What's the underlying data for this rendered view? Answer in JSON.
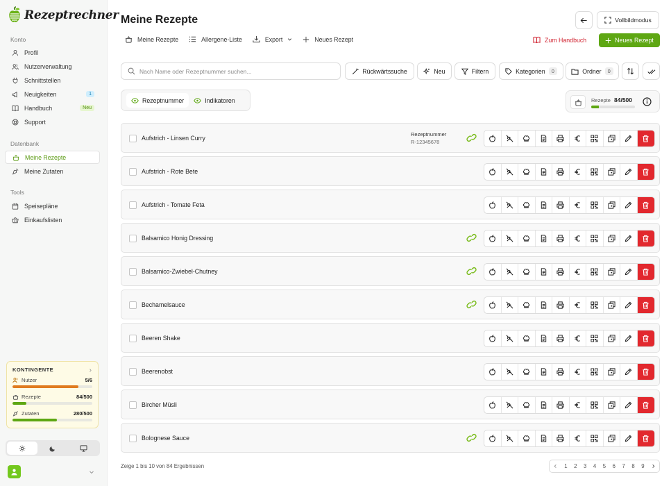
{
  "app": {
    "name": "Rezeptrechner"
  },
  "sidebar": {
    "sections": [
      {
        "title": "Konto",
        "items": [
          {
            "label": "Profil",
            "icon": "user-icon"
          },
          {
            "label": "Nutzerverwaltung",
            "icon": "users-icon"
          },
          {
            "label": "Schnittstellen",
            "icon": "plug-icon"
          },
          {
            "label": "Neuigkeiten",
            "icon": "megaphone-icon",
            "badge": "1"
          },
          {
            "label": "Handbuch",
            "icon": "book-icon",
            "badge": "Neu"
          },
          {
            "label": "Support",
            "icon": "lifebuoy-icon"
          }
        ]
      },
      {
        "title": "Datenbank",
        "items": [
          {
            "label": "Meine Rezepte",
            "icon": "pot-icon",
            "active": true
          },
          {
            "label": "Meine Zutaten",
            "icon": "carrot-icon"
          }
        ]
      },
      {
        "title": "Tools",
        "items": [
          {
            "label": "Speisepläne",
            "icon": "calendar-icon"
          },
          {
            "label": "Einkaufslisten",
            "icon": "basket-icon"
          }
        ]
      }
    ],
    "quota": {
      "title": "KONTINGENTE",
      "rows": [
        {
          "label": "Nutzer",
          "value": "5/6",
          "fraction": 0.83,
          "color": "#e07b1f"
        },
        {
          "label": "Rezepte",
          "value": "84/500",
          "fraction": 0.17,
          "color": "#5ea713"
        },
        {
          "label": "Zutaten",
          "value": "280/500",
          "fraction": 0.56,
          "color": "#5ea713"
        }
      ]
    },
    "theme": {
      "selected": "light"
    }
  },
  "header": {
    "title": "Meine Rezepte",
    "fullscreen_label": "Vollbildmodus",
    "tabs": [
      {
        "label": "Meine Rezepte",
        "icon": "pot-icon"
      },
      {
        "label": "Allergene-Liste",
        "icon": "list-icon"
      },
      {
        "label": "Export",
        "icon": "download-icon",
        "dropdown": true
      },
      {
        "label": "Neues Rezept",
        "icon": "plus-icon"
      }
    ],
    "handbook_label": "Zum Handbuch",
    "new_recipe_label": "Neues Rezept"
  },
  "toolbar": {
    "search_placeholder": "Nach Name oder Rezeptnummer suchen...",
    "reverse_search_label": "Rückwärtssuche",
    "new_label": "Neu",
    "filter_label": "Filtern",
    "categories_label": "Kategorien",
    "categories_count": "0",
    "folders_label": "Ordner",
    "folders_count": "0"
  },
  "indicators": {
    "recipe_number_label": "Rezeptnummer",
    "indicators_label": "Indikatoren"
  },
  "recipe_counter": {
    "label": "Rezepte",
    "value": "84/500",
    "fraction": 0.168
  },
  "recipes": [
    {
      "name": "Aufstrich - Linsen Curry",
      "number_label": "Rezeptnummer",
      "number": "R-12345678",
      "linked": true
    },
    {
      "name": "Aufstrich - Rote Bete",
      "linked": false
    },
    {
      "name": "Aufstrich - Tomate Feta",
      "linked": false
    },
    {
      "name": "Balsamico Honig Dressing",
      "linked": true
    },
    {
      "name": "Balsamico-Zwiebel-Chutney",
      "linked": true
    },
    {
      "name": "Bechamelsauce",
      "linked": true
    },
    {
      "name": "Beeren Shake",
      "linked": false
    },
    {
      "name": "Beerenobst",
      "linked": false
    },
    {
      "name": "Bircher Müsli",
      "linked": false
    },
    {
      "name": "Bolognese Sauce",
      "linked": true
    }
  ],
  "row_actions": [
    "apple-icon",
    "allergen-icon",
    "chef-hat-icon",
    "document-icon",
    "printer-icon",
    "euro-icon",
    "qr-code-icon",
    "duplicate-icon",
    "edit-icon",
    "trash-icon"
  ],
  "footer": {
    "summary": "Zeige 1 bis 10 von 84 Ergebnissen",
    "pages": [
      "1",
      "2",
      "3",
      "4",
      "5",
      "6",
      "7",
      "8",
      "9"
    ]
  }
}
